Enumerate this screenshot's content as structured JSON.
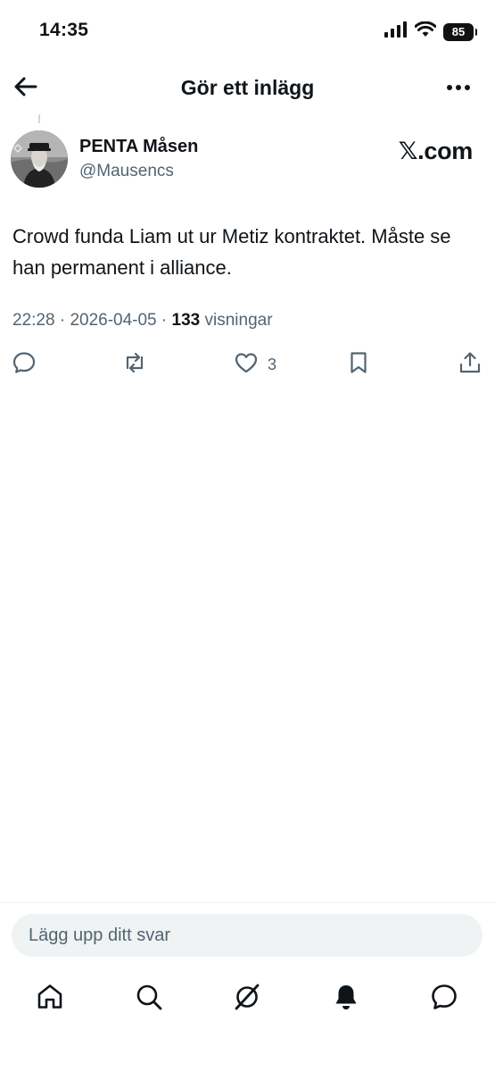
{
  "status_bar": {
    "time": "14:35",
    "battery": "85",
    "icons": [
      "signal-icon",
      "wifi-icon",
      "battery-icon"
    ]
  },
  "header": {
    "title": "Gör ett inlägg",
    "back_icon": "arrow-left-icon",
    "more_icon": "more-horizontal-icon"
  },
  "tweet": {
    "display_name": "PENTA Måsen",
    "handle": "@Mausencs",
    "source_badge": {
      "x": "𝕏",
      "domain": ".com"
    },
    "text": "Crowd funda Liam ut ur Metiz kontraktet. Måste se han permanent i alliance.",
    "time": "22:28",
    "date": "2026-04-05",
    "views_count": "133",
    "views_label": "visningar",
    "actions": {
      "reply": {
        "icon": "reply-icon"
      },
      "repost": {
        "icon": "repost-icon"
      },
      "like": {
        "icon": "heart-icon",
        "count": "3"
      },
      "bookmark": {
        "icon": "bookmark-icon"
      },
      "share": {
        "icon": "share-icon"
      }
    }
  },
  "reply": {
    "placeholder": "Lägg upp ditt svar"
  },
  "tabbar": {
    "items": [
      "home-icon",
      "search-icon",
      "grok-icon",
      "notifications-icon",
      "messages-icon"
    ]
  },
  "colors": {
    "text": "#0f1419",
    "secondary": "#536471",
    "reply_bg": "#eff3f4",
    "divider": "#eff3f4"
  }
}
